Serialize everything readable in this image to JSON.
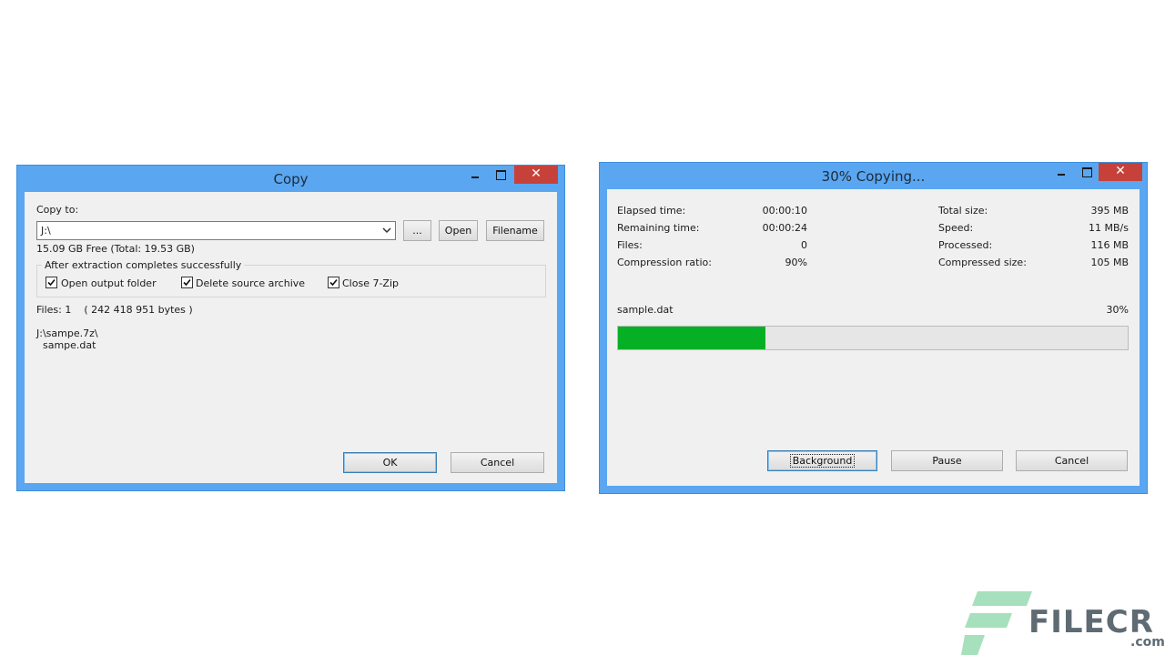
{
  "copy_dialog": {
    "title": "Copy",
    "copy_to_label": "Copy to:",
    "path_value": "J:\\",
    "browse_label": "...",
    "open_label": "Open",
    "filename_label": "Filename",
    "free_space": "15.09 GB Free (Total: 19.53 GB)",
    "group_label": "After extraction completes successfully",
    "options": [
      {
        "label": "Open output folder",
        "checked": true
      },
      {
        "label": "Delete source archive",
        "checked": true
      },
      {
        "label": "Close 7-Zip",
        "checked": true
      }
    ],
    "files_info": "Files: 1    ( 242 418 951 bytes )",
    "archive_path": "J:\\sampe.7z\\",
    "archive_file": "sampe.dat",
    "ok_label": "OK",
    "cancel_label": "Cancel"
  },
  "progress_dialog": {
    "title": "30% Copying...",
    "left_stats": [
      {
        "label": "Elapsed time:",
        "value": "00:00:10"
      },
      {
        "label": "Remaining time:",
        "value": "00:00:24"
      },
      {
        "label": "Files:",
        "value": "0"
      },
      {
        "label": "Compression ratio:",
        "value": "90%"
      }
    ],
    "right_stats": [
      {
        "label": "Total size:",
        "value": "395 MB"
      },
      {
        "label": "Speed:",
        "value": "11 MB/s"
      },
      {
        "label": "Processed:",
        "value": "116 MB"
      },
      {
        "label": "Compressed size:",
        "value": "105 MB"
      }
    ],
    "current_file": "sample.dat",
    "percent_label": "30%",
    "progress_fraction": 0.29,
    "background_label": "Background",
    "pause_label": "Pause",
    "cancel_label": "Cancel"
  },
  "watermark": {
    "brand": "FILECR",
    "suffix": ".com"
  },
  "colors": {
    "window_frame": "#5aa6f1",
    "close_button": "#c7413b",
    "progress_fill": "#06b025",
    "logo_green": "#a7e0bc",
    "logo_text": "#5f6b73"
  },
  "icons": [
    "minimize-icon",
    "maximize-icon",
    "close-icon",
    "chevron-down-icon",
    "checkmark-icon"
  ]
}
